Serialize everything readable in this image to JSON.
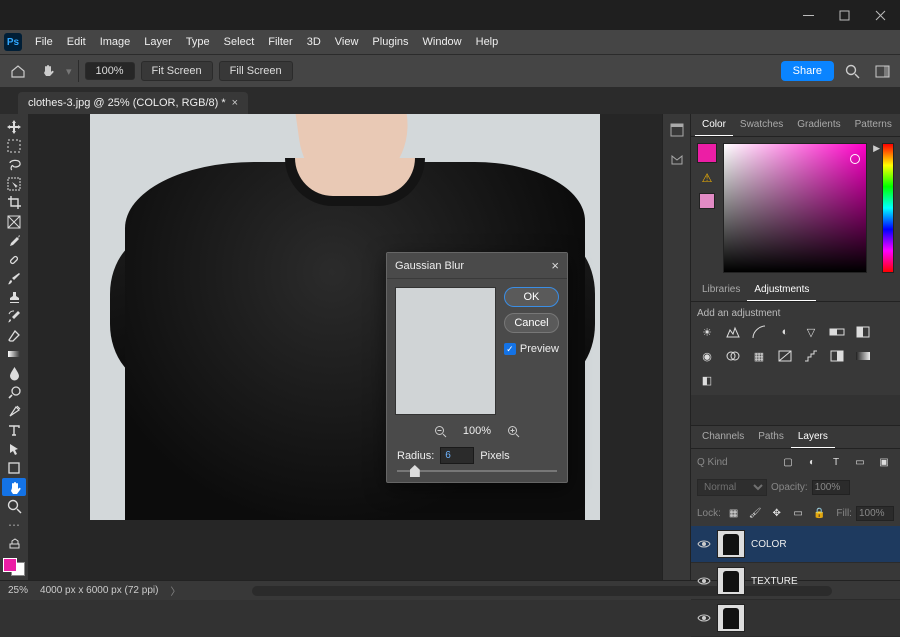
{
  "window": {
    "controls": {
      "minimize": "minimize",
      "maximize": "maximize",
      "close": "close"
    }
  },
  "menubar": {
    "logo": "Ps",
    "items": [
      "File",
      "Edit",
      "Image",
      "Layer",
      "Type",
      "Select",
      "Filter",
      "3D",
      "View",
      "Plugins",
      "Window",
      "Help"
    ]
  },
  "optionsbar": {
    "zoom_value": "100%",
    "fit_screen": "Fit Screen",
    "fill_screen": "Fill Screen",
    "share": "Share"
  },
  "document": {
    "tab_label": "clothes-3.jpg @ 25% (COLOR, RGB/8) *"
  },
  "right_tabs": {
    "color": "Color",
    "swatches": "Swatches",
    "gradients": "Gradients",
    "patterns": "Patterns"
  },
  "right_tabs2": {
    "libraries": "Libraries",
    "adjustments": "Adjustments"
  },
  "adjustments": {
    "heading": "Add an adjustment"
  },
  "layers_tabs": {
    "channels": "Channels",
    "paths": "Paths",
    "layers": "Layers"
  },
  "layers": {
    "kind_label": "Q Kind",
    "blend_mode": "Normal",
    "opacity_label": "Opacity:",
    "opacity_value": "100%",
    "lock_label": "Lock:",
    "fill_label": "Fill:",
    "fill_value": "100%",
    "items": [
      {
        "name": "COLOR"
      },
      {
        "name": "TEXTURE"
      }
    ]
  },
  "statusbar": {
    "zoom": "25%",
    "info": "4000 px x 6000 px (72 ppi)"
  },
  "dialog": {
    "title": "Gaussian Blur",
    "ok": "OK",
    "cancel": "Cancel",
    "preview": "Preview",
    "zoom_value": "100%",
    "radius_label": "Radius:",
    "radius_value": "6",
    "radius_unit": "Pixels"
  },
  "colors": {
    "foreground": "#ec1ea5",
    "background": "#ffffff"
  }
}
